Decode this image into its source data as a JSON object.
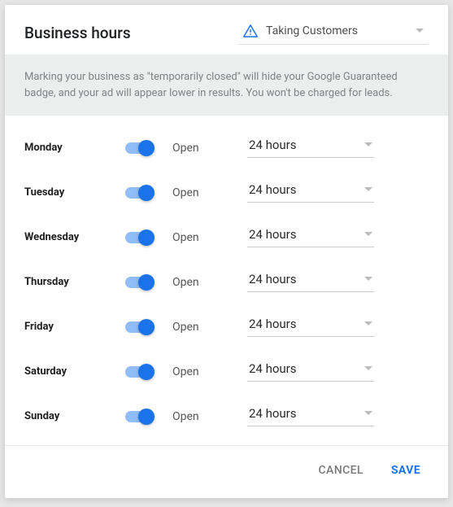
{
  "header": {
    "title": "Business hours",
    "status": "Taking Customers"
  },
  "banner": "Marking your business as \"temporarily closed\" will hide your Google Guaranteed badge, and your ad will appear lower in results. You won't be charged for leads.",
  "days": [
    {
      "name": "Monday",
      "state": "Open",
      "hours": "24 hours"
    },
    {
      "name": "Tuesday",
      "state": "Open",
      "hours": "24 hours"
    },
    {
      "name": "Wednesday",
      "state": "Open",
      "hours": "24 hours"
    },
    {
      "name": "Thursday",
      "state": "Open",
      "hours": "24 hours"
    },
    {
      "name": "Friday",
      "state": "Open",
      "hours": "24 hours"
    },
    {
      "name": "Saturday",
      "state": "Open",
      "hours": "24 hours"
    },
    {
      "name": "Sunday",
      "state": "Open",
      "hours": "24 hours"
    }
  ],
  "actions": {
    "cancel": "Cancel",
    "save": "Save"
  }
}
